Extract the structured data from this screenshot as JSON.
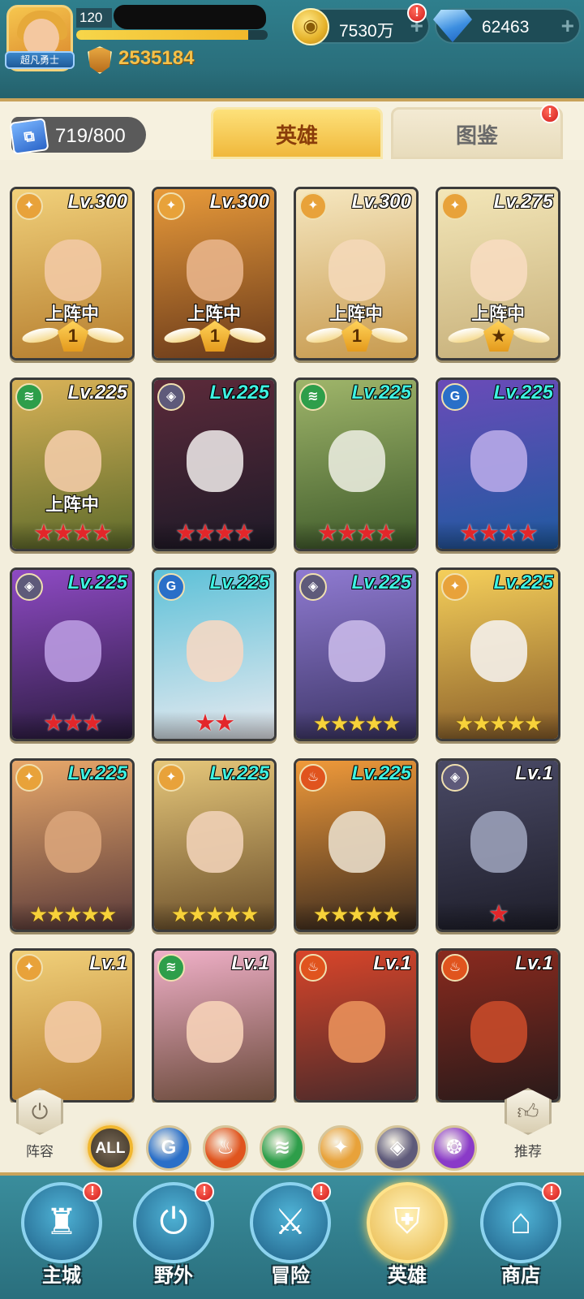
{
  "player": {
    "level": "120",
    "title": "超凡勇士",
    "power": "2535184",
    "xp_fraction": 0.9
  },
  "currency": {
    "gold": "7530万",
    "gems": "62463",
    "plus": "+",
    "alert": "!"
  },
  "tabs": {
    "card_count": "719/800",
    "heroes": "英雄",
    "codex": "图鉴"
  },
  "heroes": [
    {
      "level": "Lv.300",
      "level_color": "white",
      "element": "light",
      "status": "上阵中",
      "badge_type": "wings",
      "badge_text": "1",
      "bg": [
        "#f1d07a",
        "#b57d2e"
      ],
      "face": "#f2c9a4"
    },
    {
      "level": "Lv.300",
      "level_color": "white",
      "element": "light",
      "status": "上阵中",
      "badge_type": "wings",
      "badge_text": "1",
      "bg": [
        "#e89a3a",
        "#6a3a1a"
      ],
      "face": "#e8b48a"
    },
    {
      "level": "Lv.300",
      "level_color": "white",
      "element": "light",
      "status": "上阵中",
      "badge_type": "wings",
      "badge_text": "1",
      "bg": [
        "#f6e7c0",
        "#c79a4e"
      ],
      "face": "#f4d8b8"
    },
    {
      "level": "Lv.275",
      "level_color": "white",
      "element": "light",
      "status": "上阵中",
      "badge_type": "wings",
      "badge_text": "★",
      "bg": [
        "#f3e6b8",
        "#c7b07a"
      ],
      "face": "#f7dcc0"
    },
    {
      "level": "Lv.225",
      "level_color": "white",
      "element": "forest",
      "status": "上阵中",
      "badge_type": "stars",
      "star_color": "red",
      "stars": "★★★★",
      "bg": [
        "#d9b257",
        "#5c6a2a"
      ],
      "face": "#f2cba6"
    },
    {
      "level": "Lv.225",
      "level_color": "cyan",
      "element": "void",
      "status": "",
      "badge_type": "stars",
      "star_color": "red",
      "stars": "★★★★",
      "bg": [
        "#5b2a3a",
        "#1e1a28"
      ],
      "face": "#e8e2e2"
    },
    {
      "level": "Lv.225",
      "level_color": "cyan",
      "element": "forest",
      "status": "",
      "badge_type": "stars",
      "star_color": "red",
      "stars": "★★★★",
      "bg": [
        "#9fb56a",
        "#3e5a2a"
      ],
      "face": "#e8eadc"
    },
    {
      "level": "Lv.225",
      "level_color": "cyan",
      "element": "water",
      "status": "",
      "badge_type": "stars",
      "star_color": "red",
      "stars": "★★★★",
      "bg": [
        "#6a4bb8",
        "#1f5aa0"
      ],
      "face": "#b7a8e8"
    },
    {
      "level": "Lv.225",
      "level_color": "cyan",
      "element": "void",
      "status": "",
      "badge_type": "stars",
      "star_color": "red",
      "stars": "★★★",
      "bg": [
        "#8e4ac4",
        "#2a1b3e"
      ],
      "face": "#b99ae0"
    },
    {
      "level": "Lv.225",
      "level_color": "cyan",
      "element": "water",
      "status": "",
      "badge_type": "stars",
      "star_color": "red",
      "stars": "★★",
      "bg": [
        "#5ec1d8",
        "#e8eaf0"
      ],
      "face": "#f4d8c4"
    },
    {
      "level": "Lv.225",
      "level_color": "cyan",
      "element": "void",
      "status": "",
      "badge_type": "stars",
      "star_color": "gold",
      "stars": "★★★★★",
      "bg": [
        "#8f7ad1",
        "#3c3566"
      ],
      "face": "#c8b8e8"
    },
    {
      "level": "Lv.225",
      "level_color": "cyan",
      "element": "light",
      "status": "",
      "badge_type": "stars",
      "star_color": "gold",
      "stars": "★★★★★",
      "bg": [
        "#f5cf5a",
        "#8a5f2a"
      ],
      "face": "#f4f0ea"
    },
    {
      "level": "Lv.225",
      "level_color": "cyan",
      "element": "light",
      "status": "",
      "badge_type": "stars",
      "star_color": "gold",
      "stars": "★★★★★",
      "bg": [
        "#e8a86a",
        "#5a3a3a"
      ],
      "face": "#d9a47a"
    },
    {
      "level": "Lv.225",
      "level_color": "cyan",
      "element": "light",
      "status": "",
      "badge_type": "stars",
      "star_color": "gold",
      "stars": "★★★★★",
      "bg": [
        "#e6c77a",
        "#6a4e2a"
      ],
      "face": "#f0d0b6"
    },
    {
      "level": "Lv.225",
      "level_color": "cyan",
      "element": "fire",
      "status": "",
      "badge_type": "stars",
      "star_color": "gold",
      "stars": "★★★★★",
      "bg": [
        "#f09a3a",
        "#3a2a1e"
      ],
      "face": "#e8dcc8"
    },
    {
      "level": "Lv.1",
      "level_color": "white",
      "element": "void",
      "status": "",
      "badge_type": "stars",
      "star_color": "red",
      "stars": "★",
      "bg": [
        "#4a4a66",
        "#1e1e2a"
      ],
      "face": "#9aa0b8"
    },
    {
      "level": "Lv.1",
      "level_color": "white",
      "element": "light",
      "status": "",
      "badge_type": "none",
      "bg": [
        "#f1d07a",
        "#b57d2e"
      ],
      "face": "#f2c9a4"
    },
    {
      "level": "Lv.1",
      "level_color": "white",
      "element": "forest",
      "status": "",
      "badge_type": "none",
      "bg": [
        "#f0b0c8",
        "#6a4a3a"
      ],
      "face": "#f6d2b8"
    },
    {
      "level": "Lv.1",
      "level_color": "white",
      "element": "fire",
      "status": "",
      "badge_type": "none",
      "bg": [
        "#d9452a",
        "#4a2a2a"
      ],
      "face": "#e8905a"
    },
    {
      "level": "Lv.1",
      "level_color": "white",
      "element": "fire",
      "status": "",
      "badge_type": "none",
      "bg": [
        "#8a2a1e",
        "#2a1a1a"
      ],
      "face": "#c74a2a"
    }
  ],
  "elements": {
    "light": {
      "icon": "✦",
      "color": "#e8a23a"
    },
    "forest": {
      "icon": "≋",
      "color": "#2e9e4a"
    },
    "void": {
      "icon": "◈",
      "color": "#5e5a7a"
    },
    "water": {
      "icon": "G",
      "color": "#2a6fc8"
    },
    "fire": {
      "icon": "♨",
      "color": "#e0541e"
    },
    "shadow": {
      "icon": "❂",
      "color": "#8a3ac8"
    }
  },
  "filter": {
    "lineup_label": "阵容",
    "recommend_label": "推荐",
    "all_label": "ALL",
    "factions": [
      "water",
      "fire",
      "forest",
      "light",
      "void",
      "shadow"
    ]
  },
  "nav": [
    {
      "label": "主城",
      "symbol": "♜",
      "alert": true,
      "active": false
    },
    {
      "label": "野外",
      "symbol": "⏻",
      "alert": true,
      "active": false
    },
    {
      "label": "冒险",
      "symbol": "⚔",
      "alert": true,
      "active": false
    },
    {
      "label": "英雄",
      "symbol": "⛨",
      "alert": false,
      "active": true
    },
    {
      "label": "商店",
      "symbol": "⌂",
      "alert": true,
      "active": false
    }
  ]
}
